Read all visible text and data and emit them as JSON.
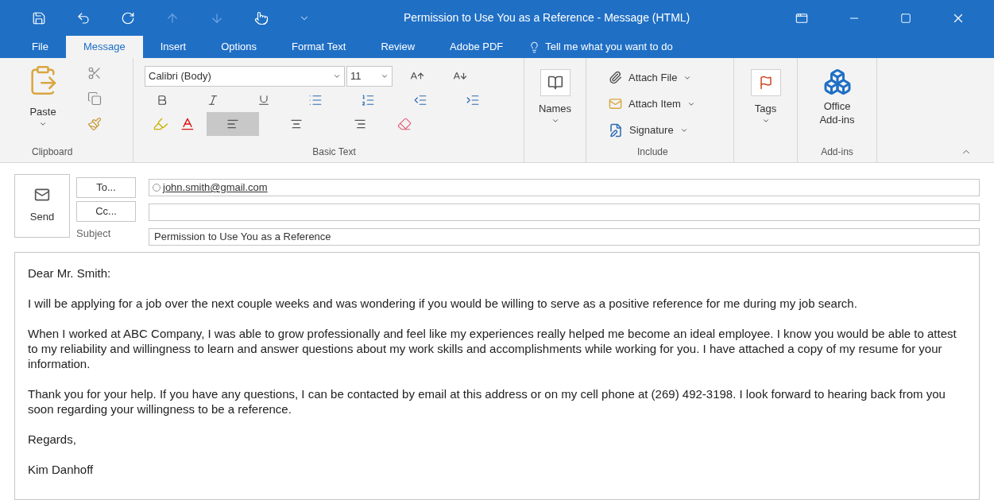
{
  "window": {
    "title": "Permission to Use You as a Reference  -  Message (HTML)"
  },
  "tabs": [
    {
      "label": "File",
      "selected": false
    },
    {
      "label": "Message",
      "selected": true
    },
    {
      "label": "Insert",
      "selected": false
    },
    {
      "label": "Options",
      "selected": false
    },
    {
      "label": "Format Text",
      "selected": false
    },
    {
      "label": "Review",
      "selected": false
    },
    {
      "label": "Adobe PDF",
      "selected": false
    }
  ],
  "tell_me": "Tell me what you want to do",
  "ribbon": {
    "clipboard": {
      "paste": "Paste",
      "label": "Clipboard"
    },
    "basic_text": {
      "font": "Calibri (Body)",
      "size": "11",
      "label": "Basic Text",
      "align_buttons": [
        {
          "selected": true
        },
        {
          "selected": false
        },
        {
          "selected": false
        }
      ]
    },
    "names": {
      "label": "Names"
    },
    "include": {
      "items": [
        "Attach File",
        "Attach Item",
        "Signature"
      ],
      "label": "Include"
    },
    "tags": {
      "label": "Tags"
    },
    "add_ins": {
      "button": "Office Add-ins",
      "label": "Add-ins"
    }
  },
  "compose": {
    "send": "Send",
    "to_button": "To...",
    "cc_button": "Cc...",
    "subject_label": "Subject",
    "to_value": "john.smith@gmail.com",
    "subject_value": "Permission to Use You as a Reference"
  },
  "body": [
    "Dear Mr. Smith:",
    "I will be applying for a job over the next couple weeks and was wondering if you would be willing to serve as a positive reference for me during my job search.",
    "When I worked at ABC Company, I was able to grow professionally and feel like my experiences really helped me become an ideal employee.  I know you would be able to attest to my reliability and willingness to learn and answer questions about my work skills and accomplishments while working for you.  I have attached a copy of my resume for your information.",
    "Thank you for your help.  If you have any questions, I can be contacted by email at this address or on my cell phone at (269) 492-3198.  I look forward to hearing back from you soon regarding your willingness to be a reference.",
    "Regards,",
    "Kim Danhoff"
  ]
}
